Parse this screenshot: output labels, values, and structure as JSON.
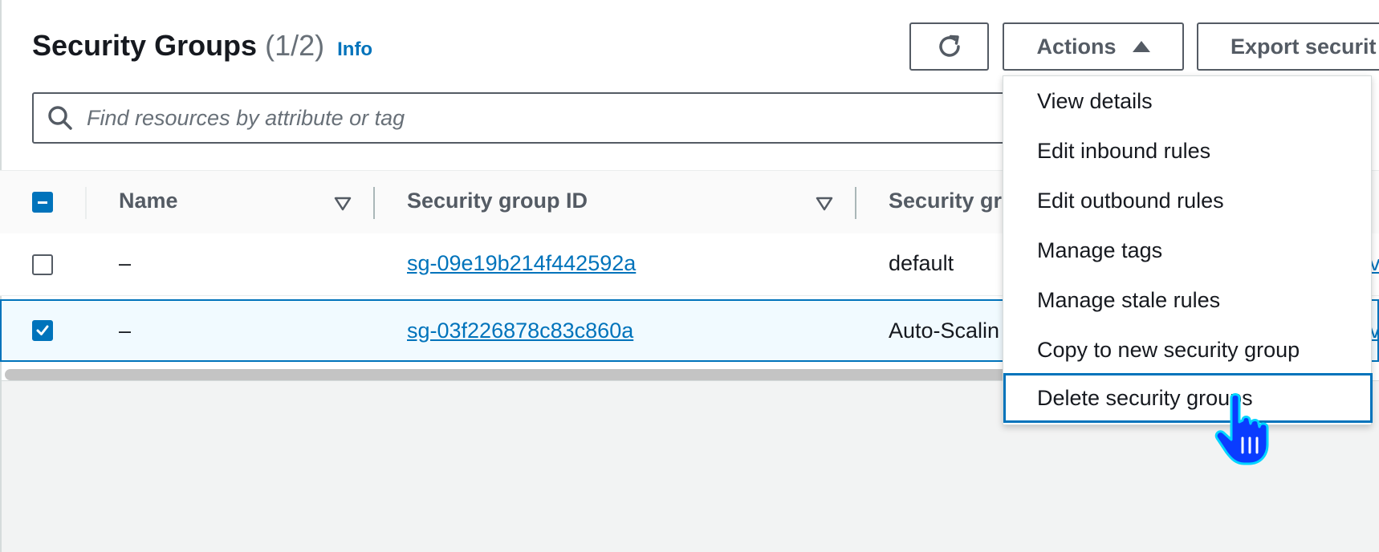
{
  "header": {
    "title": "Security Groups",
    "count": "(1/2)",
    "info_link": "Info",
    "actions_label": "Actions",
    "export_label": "Export securit"
  },
  "search": {
    "placeholder": "Find resources by attribute or tag"
  },
  "table": {
    "columns": [
      {
        "label": "Name",
        "sortable": true
      },
      {
        "label": "Security group ID",
        "sortable": true
      },
      {
        "label": "Security gr",
        "sortable": false
      }
    ],
    "header_checkbox": "indeterminate",
    "rows": [
      {
        "selected": false,
        "name": "–",
        "group_id": "sg-09e19b214f442592a",
        "group_name": "default",
        "vpc": "v"
      },
      {
        "selected": true,
        "name": "–",
        "group_id": "sg-03f226878c83c860a",
        "group_name": "Auto-Scalin",
        "vpc": "v"
      }
    ]
  },
  "actions_menu": {
    "items": [
      "View details",
      "Edit inbound rules",
      "Edit outbound rules",
      "Manage tags",
      "Manage stale rules",
      "Copy to new security group",
      "Delete security groups"
    ],
    "highlighted_item": "Delete security groups"
  },
  "icons": {
    "refresh": "refresh-icon",
    "search": "search-icon",
    "caret": "caret-up-icon",
    "sort": "sort-down-icon",
    "cursor": "hand-pointer-cursor-icon"
  },
  "colors": {
    "link": "#0073bb",
    "selected_row_bg": "#f1faff",
    "selected_row_border": "#0073bb",
    "checkbox_checked": "#0073bb",
    "text_secondary": "#545b64",
    "cursor": "#0a3cff"
  }
}
